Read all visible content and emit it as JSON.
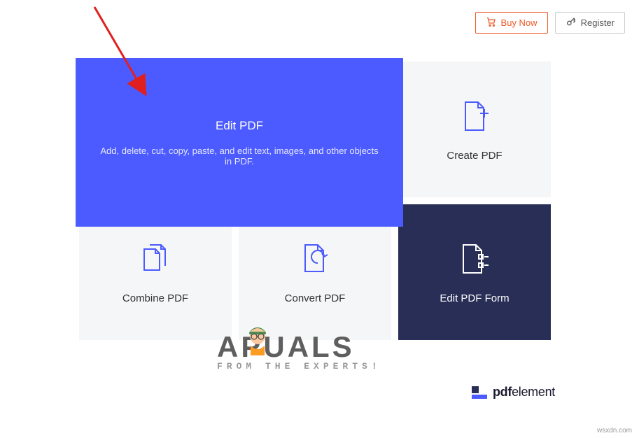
{
  "top_bar": {
    "buy_label": "Buy Now",
    "register_label": "Register"
  },
  "edit_card": {
    "title": "Edit PDF",
    "description": "Add, delete, cut, copy, paste, and edit text, images, and other objects in PDF."
  },
  "cards": {
    "create": "Create PDF",
    "combine": "Combine PDF",
    "convert": "Convert PDF",
    "edit_form": "Edit PDF Form"
  },
  "footer": {
    "brand_bold": "pdf",
    "brand_light": "element"
  },
  "watermark": {
    "main_left": "A",
    "main_right": "PUALS",
    "sub": "FROM THE EXPERTS!"
  },
  "corner": "wsxdn.com"
}
